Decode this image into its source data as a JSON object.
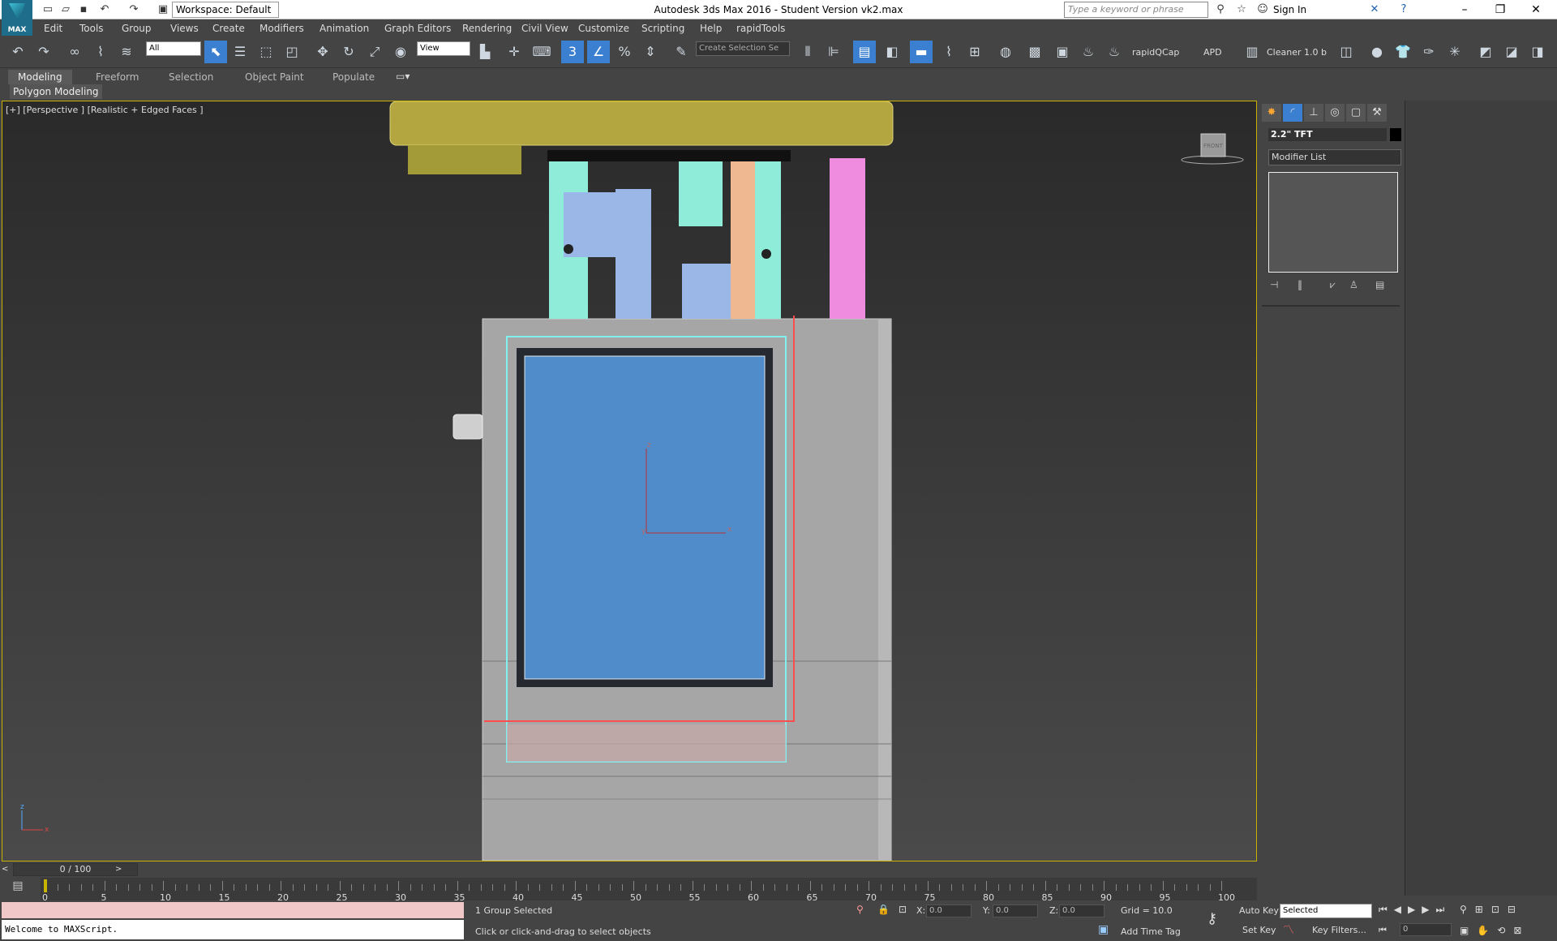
{
  "title_bar": {
    "app_title": "Autodesk 3ds Max 2016 - Student Version     vk2.max",
    "logo_label": "MAX",
    "workspace": "Workspace: Default",
    "search_placeholder": "Type a keyword or phrase",
    "sign_in": "Sign In"
  },
  "menu": [
    "Edit",
    "Tools",
    "Group",
    "Views",
    "Create",
    "Modifiers",
    "Animation",
    "Graph Editors",
    "Rendering",
    "Civil View",
    "Customize",
    "Scripting",
    "Help",
    "rapidTools"
  ],
  "toolbar": {
    "filter": "All",
    "ref_coord": "View",
    "selection_set": "Create Selection Se",
    "angle_snap_label": "3",
    "rapidqcap": "rapidQCap",
    "apd": "APD",
    "cleaner": "Cleaner 1.0 b"
  },
  "ribbon": {
    "tabs": [
      "Modeling",
      "Freeform",
      "Selection",
      "Object Paint",
      "Populate"
    ],
    "active_tab": "Modeling",
    "sub_label": "Polygon Modeling"
  },
  "viewport": {
    "label": "[+] [Perspective ] [Realistic + Edged Faces ]",
    "viewcube_label": "FRONT",
    "gizmo": {
      "x": "x",
      "y": "y",
      "z": "z"
    },
    "corner_axes": {
      "x": "x",
      "z": "z"
    }
  },
  "command_panel": {
    "object_name": "2.2\" TFT",
    "modifier_list": "Modifier List"
  },
  "timeline": {
    "frame_display": "0 / 100",
    "ticks": [
      "0",
      "5",
      "10",
      "15",
      "20",
      "25",
      "30",
      "35",
      "40",
      "45",
      "50",
      "55",
      "60",
      "65",
      "70",
      "75",
      "80",
      "85",
      "90",
      "95",
      "100"
    ]
  },
  "status": {
    "maxscript_output": "Welcome to MAXScript.",
    "selection": "1 Group Selected",
    "prompt": "Click or click-and-drag to select objects",
    "x_label": "X:",
    "y_label": "Y:",
    "z_label": "Z:",
    "x": "0.0",
    "y": "0.0",
    "z": "0.0",
    "grid": "Grid = 10.0",
    "add_time_tag": "Add Time Tag",
    "auto_key": "Auto Key",
    "set_key": "Set Key",
    "key_mode": "Selected",
    "key_filters": "Key Filters...",
    "frame": "0"
  },
  "colors": {
    "viewport_border": "#c8b400",
    "accent": "#3b7fd0",
    "screen_blue": "#4f8cc9",
    "yellow_part": "#b3a640"
  }
}
